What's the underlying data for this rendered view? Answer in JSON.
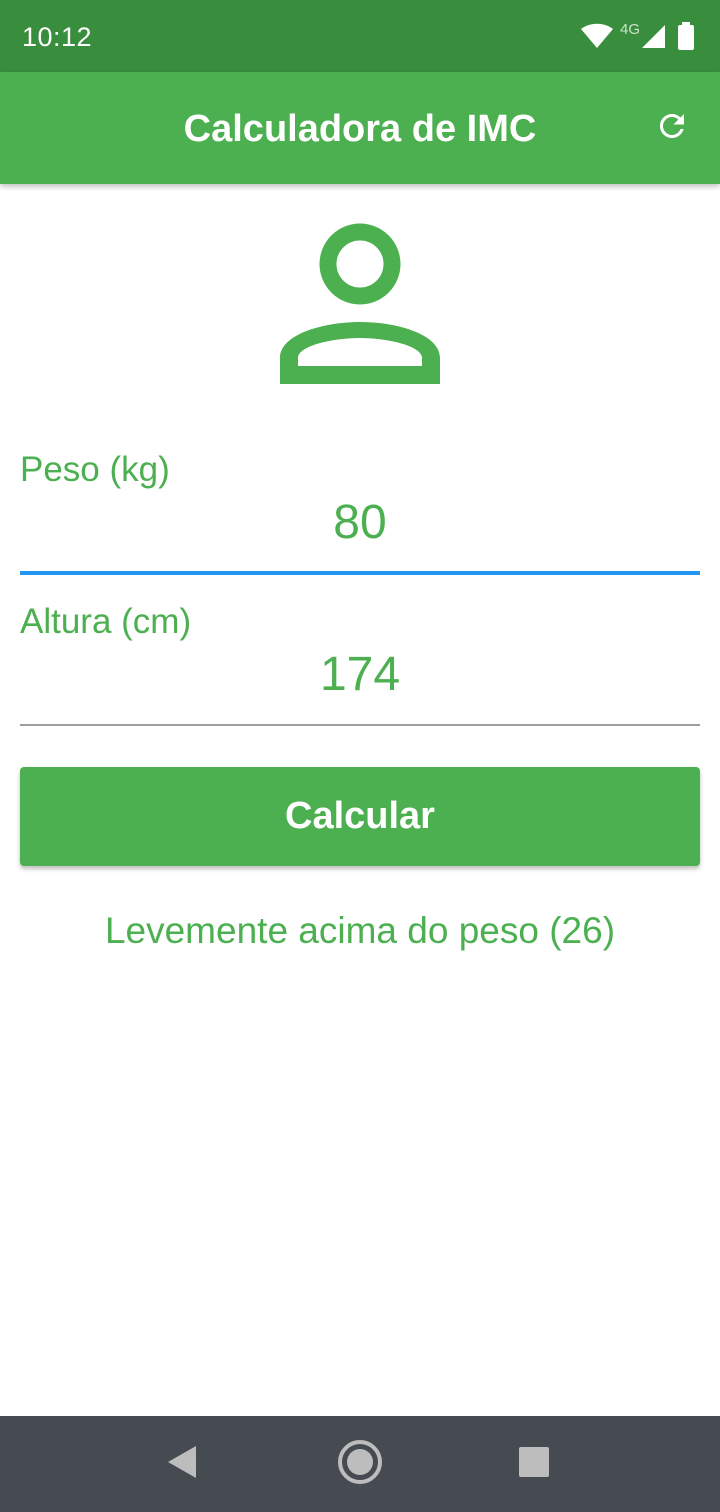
{
  "status_bar": {
    "time": "10:12",
    "network": "4G",
    "icons": [
      "wifi-icon",
      "signal-icon",
      "battery-icon"
    ]
  },
  "app_bar": {
    "title": "Calculadora de IMC",
    "refresh_icon": "refresh-icon"
  },
  "main": {
    "avatar_icon": "person-icon",
    "weight": {
      "label": "Peso (kg)",
      "value": "80"
    },
    "height": {
      "label": "Altura (cm)",
      "value": "174"
    },
    "calculate_label": "Calcular",
    "result": "Levemente acima do peso (26)"
  },
  "nav_bar": {
    "icons": [
      "back-icon",
      "home-icon",
      "recents-icon"
    ]
  },
  "colors": {
    "primary": "#4CAF50",
    "primary_dark": "#388E3C",
    "focus_underline": "#2196F3",
    "nav_bar": "#454B51"
  }
}
